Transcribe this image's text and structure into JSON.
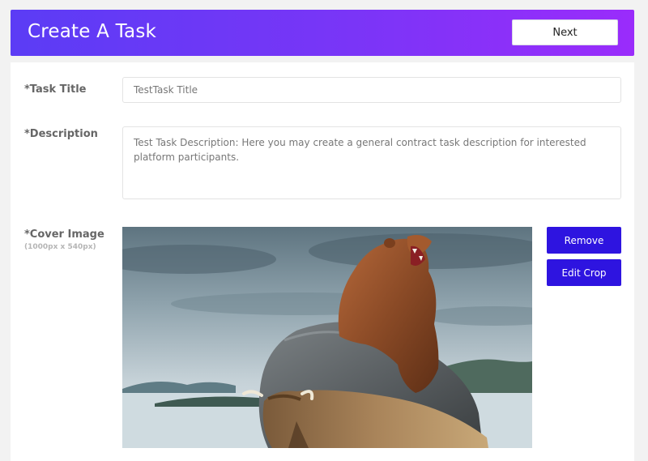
{
  "header": {
    "title": "Create A Task",
    "next_label": "Next"
  },
  "form": {
    "task_title": {
      "label": "*Task Title",
      "value": "TestTask Title"
    },
    "description": {
      "label": "*Description",
      "value": "Test Task Description: Here you may create a general contract task description for interested platform participants."
    },
    "cover_image": {
      "label": "*Cover Image",
      "size_hint": "(1000px x 540px)",
      "remove_label": "Remove",
      "edit_crop_label": "Edit Crop"
    }
  },
  "colors": {
    "header_gradient_start": "#5b3cf5",
    "header_gradient_end": "#9a2cfb",
    "action_button": "#2e14e0"
  }
}
